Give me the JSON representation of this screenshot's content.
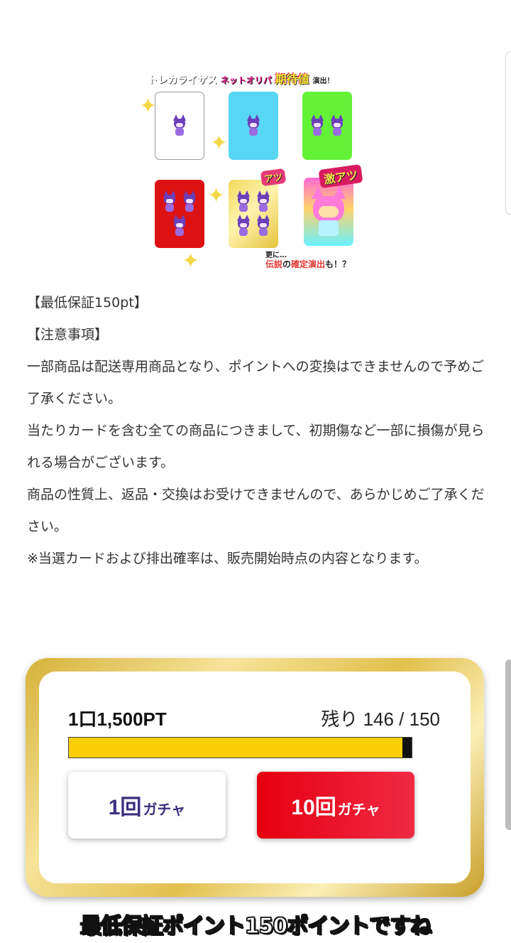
{
  "banner": {
    "title_part1": "トレカライザス",
    "title_part2": "ネットオリパ",
    "title_part3": "期待値",
    "title_part4": "演出！",
    "callout_small": "アツ",
    "callout_big": "激アツ",
    "footer_line1": "更に…",
    "footer_word1": "伝説",
    "footer_word2": "の",
    "footer_word3": "確定演出",
    "footer_word4": "も！？"
  },
  "description": [
    "【最低保証150pt】",
    "【注意事項】",
    "一部商品は配送専用商品となり、ポイントへの変換はできませんので予めご了承ください。",
    "当たりカードを含む全ての商品につきまして、初期傷など一部に損傷が見られる場合がございます。",
    "商品の性質上、返品・交換はお受けできませんので、あらかじめご了承ください。",
    "※当選カードおよび排出確率は、販売開始時点の内容となります。"
  ],
  "purchase": {
    "price_label": "1口1,500PT",
    "remaining_label": "残り 146 / 150",
    "remaining": 146,
    "total": 150,
    "button_one_number": "1回",
    "button_one_suffix": "ガチャ",
    "button_ten_number": "10回",
    "button_ten_suffix": "ガチャ"
  },
  "caption": "最低保証ポイント150ポイントですね",
  "colors": {
    "bar_fill": "#f8cf08",
    "ten_button": "#e6000f",
    "one_button_text": "#3b2f7e",
    "frame_gold": "#d6b23a"
  }
}
